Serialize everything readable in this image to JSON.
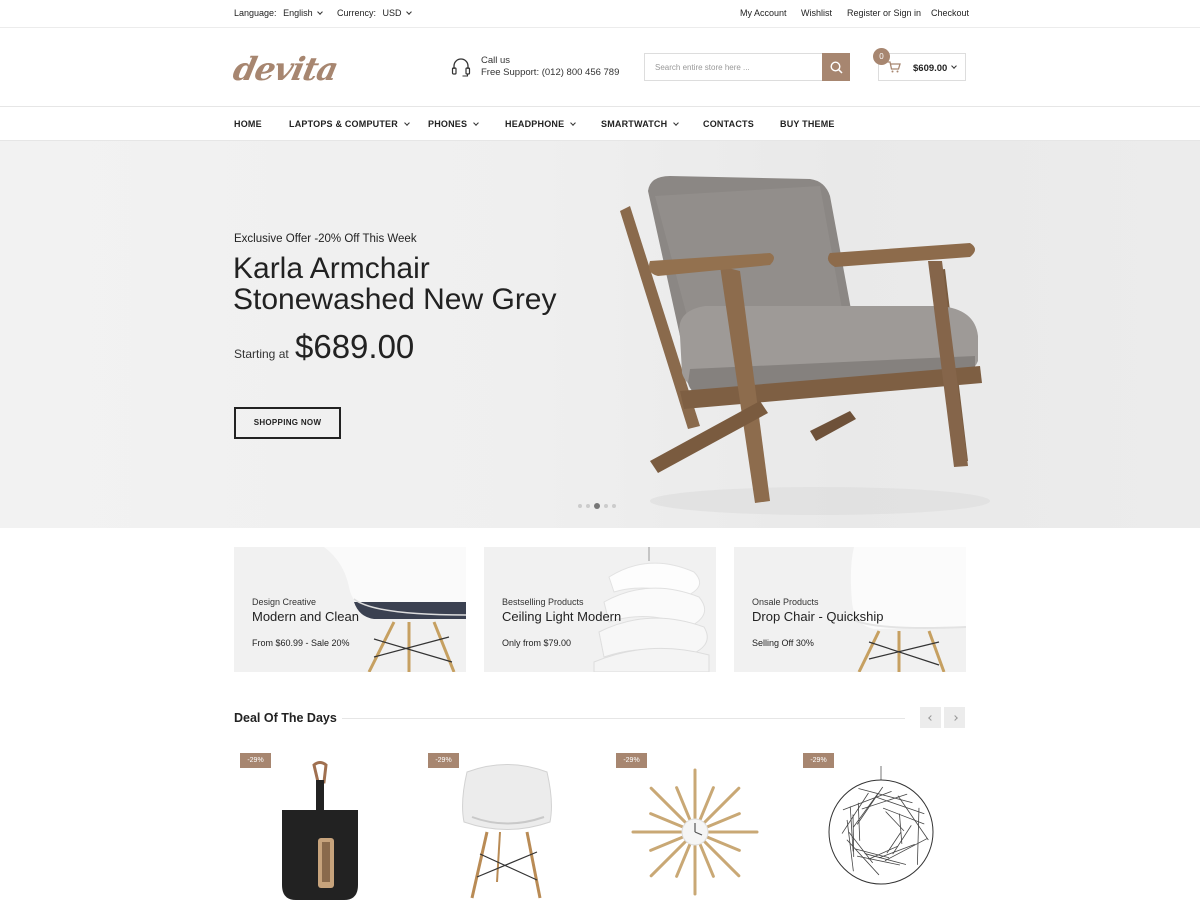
{
  "topbar": {
    "language_label": "Language:",
    "language_value": "English",
    "currency_label": "Currency:",
    "currency_value": "USD",
    "links": [
      "My Account",
      "Wishlist",
      "Register or Sign in",
      "Checkout"
    ]
  },
  "header": {
    "logo": "devita",
    "support_line1": "Call us",
    "support_line2": "Free Support: (012) 800 456 789",
    "search_placeholder": "Search entire store here ...",
    "cart_count": "0",
    "cart_total": "$609.00"
  },
  "nav": {
    "items": [
      "HOME",
      "LAPTOPS & COMPUTER",
      "PHONES",
      "HEADPHONE",
      "SMARTWATCH",
      "CONTACTS",
      "BUY THEME"
    ]
  },
  "hero": {
    "subtitle": "Exclusive Offer -20% Off This Week",
    "title_line1": "Karla Armchair",
    "title_line2": "Stonewashed New Grey",
    "starting_label": "Starting at",
    "price": "$689.00",
    "button": "SHOPPING NOW",
    "slides": 5,
    "active_slide": 3
  },
  "banners": [
    {
      "sub": "Design Creative",
      "title": "Modern and Clean",
      "price": "From  $60.99 - Sale 20%"
    },
    {
      "sub": "Bestselling Products",
      "title": "Ceiling Light Modern",
      "price": "Only  from  $79.00"
    },
    {
      "sub": "Onsale Products",
      "title": "Drop Chair - Quickship",
      "price": "Selling Off  30%"
    }
  ],
  "deals": {
    "title": "Deal Of The Days",
    "products": [
      {
        "badge": "-29%",
        "icon": "dustpan-icon"
      },
      {
        "badge": "-29%",
        "icon": "chair-icon"
      },
      {
        "badge": "-29%",
        "icon": "starburst-clock-icon"
      },
      {
        "badge": "-29%",
        "icon": "sphere-lamp-icon"
      }
    ]
  },
  "colors": {
    "accent": "#a78670",
    "text": "#222222",
    "hero_bg": "#efefef"
  }
}
